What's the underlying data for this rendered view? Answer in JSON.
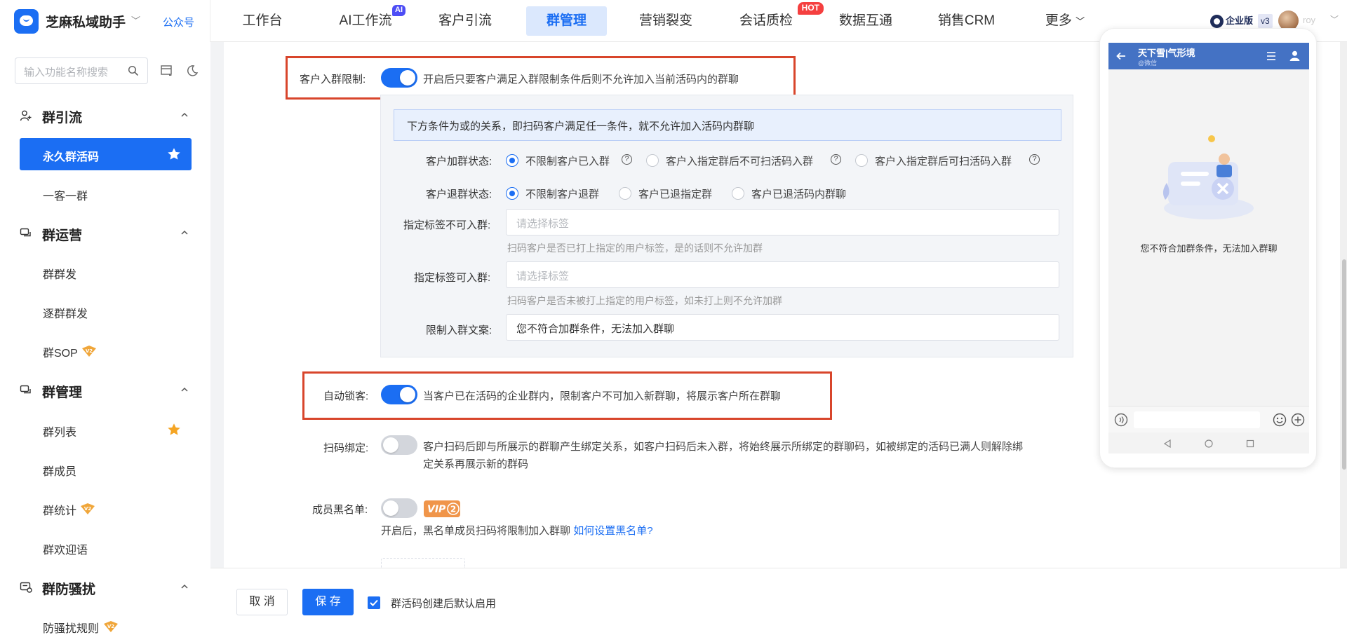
{
  "topbar": {
    "app_name": "芝麻私域助手",
    "public_account": "公众号",
    "nav": [
      {
        "label": "工作台"
      },
      {
        "label": "AI工作流",
        "badge": "AI"
      },
      {
        "label": "客户引流"
      },
      {
        "label": "群管理",
        "active": true
      },
      {
        "label": "营销裂变"
      },
      {
        "label": "会话质检",
        "badge": "HOT"
      },
      {
        "label": "数据互通"
      },
      {
        "label": "销售CRM"
      },
      {
        "label": "更多"
      }
    ],
    "edition": "企业版",
    "version": "v3",
    "user_name": "roy"
  },
  "sidebar": {
    "search_placeholder": "输入功能名称搜索",
    "groups": [
      {
        "title": "群引流",
        "items": [
          "永久群活码",
          "一客一群"
        ]
      },
      {
        "title": "群运营",
        "items": [
          "群群发",
          "逐群群发",
          "群SOP"
        ]
      },
      {
        "title": "群管理",
        "items": [
          "群列表",
          "群成员",
          "群统计",
          "群欢迎语"
        ]
      },
      {
        "title": "群防骚扰",
        "items": [
          "防骚扰规则"
        ]
      }
    ]
  },
  "form": {
    "group_limit": {
      "label": "客户入群限制:",
      "desc": "开启后只要客户满足入群限制条件后则不允许加入当前活码内的群聊",
      "enabled": true
    },
    "notice": "下方条件为或的关系，即扫码客户满足任一条件，就不允许加入活码内群聊",
    "join_status": {
      "label": "客户加群状态:",
      "options": [
        "不限制客户已入群",
        "客户入指定群后不可扫活码入群",
        "客户入指定群后可扫活码入群"
      ],
      "selected": "不限制客户已入群"
    },
    "quit_status": {
      "label": "客户退群状态:",
      "options": [
        "不限制客户退群",
        "客户已退指定群",
        "客户已退活码内群聊"
      ],
      "selected": "不限制客户退群"
    },
    "tag_block": {
      "label": "指定标签不可入群:",
      "placeholder": "请选择标签",
      "help": "扫码客户是否已打上指定的用户标签，是的话则不允许加群"
    },
    "tag_allow": {
      "label": "指定标签可入群:",
      "placeholder": "请选择标签",
      "help": "扫码客户是否未被打上指定的用户标签，如未打上则不允许加群"
    },
    "limit_text": {
      "label": "限制入群文案:",
      "value": "您不符合加群条件，无法加入群聊"
    },
    "auto_lock": {
      "label": "自动锁客:",
      "desc": "当客户已在活码的企业群内，限制客户不可加入新群聊，将展示客户所在群聊",
      "enabled": true
    },
    "scan_bind": {
      "label": "扫码绑定:",
      "desc_line1": "客户扫码后即与所展示的群聊产生绑定关系，如客户扫码后未入群，将始终展示所绑定的群聊码，如被绑定的活码已满人则解除绑",
      "desc_line2": "定关系再展示新的群码",
      "enabled": false
    },
    "blacklist": {
      "label": "成员黑名单:",
      "enabled": false,
      "vip_badge": "VIP 2",
      "help": "开启后，黑名单成员扫码将限制加入群聊",
      "link": "如何设置黑名单?"
    }
  },
  "phone": {
    "title": "天下雪|气形境",
    "subtitle": "@微信",
    "message": "您不符合加群条件，无法加入群聊"
  },
  "footer": {
    "cancel": "取 消",
    "save": "保 存",
    "checkbox_label": "群活码创建后默认启用",
    "checkbox_checked": true
  },
  "colors": {
    "primary": "#1b6ef3",
    "highlight_box": "#d8452b",
    "vip": "#f0954a"
  }
}
